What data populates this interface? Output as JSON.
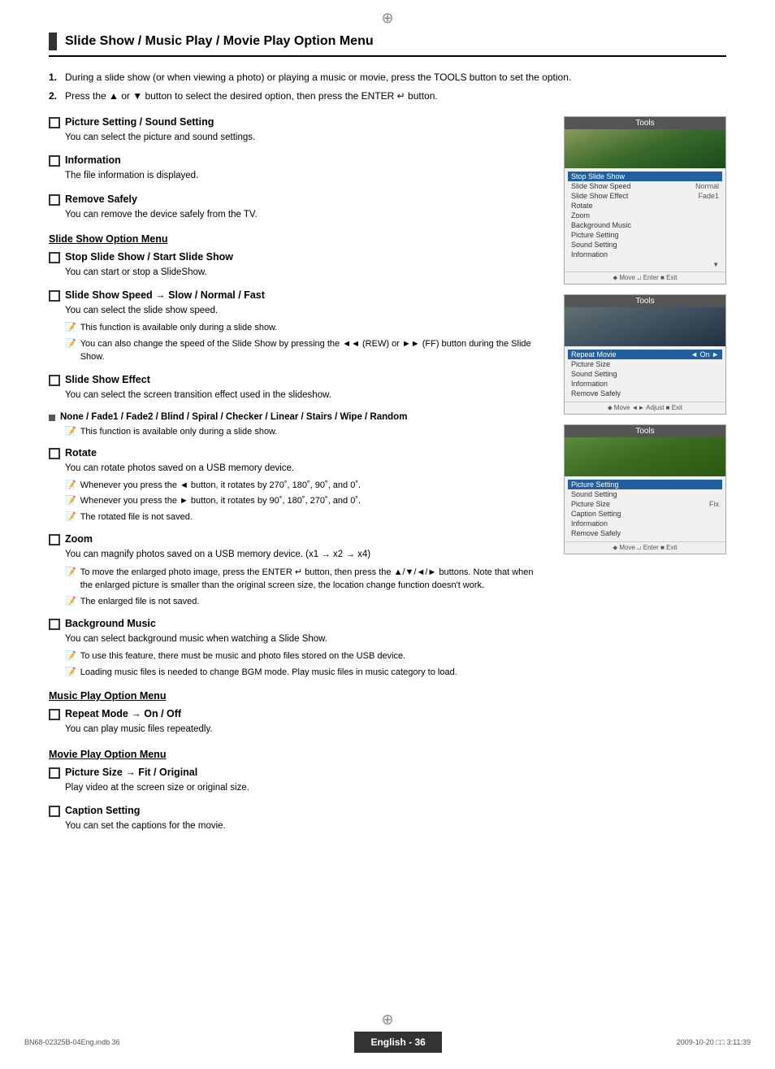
{
  "header": {
    "title": "Slide Show / Music Play / Movie Play Option Menu"
  },
  "intro": {
    "step1": "During a slide show (or when viewing a photo) or playing a music or movie, press the TOOLS button to set the option.",
    "step2": "Press the ▲ or ▼ button to select the desired option, then press the ENTER ↵ button."
  },
  "sections": {
    "pictureSetting": {
      "title": "Picture Setting / Sound Setting",
      "desc": "You can select the picture and sound settings."
    },
    "information": {
      "title": "Information",
      "desc": "The file information is displayed."
    },
    "removeSafely": {
      "title": "Remove Safely",
      "desc": "You can remove the device safely from the TV."
    },
    "slideshowOption": {
      "heading": "Slide Show Option Menu"
    },
    "stopSlideShow": {
      "title": "Stop Slide Show / Start Slide Show",
      "desc": "You can start or stop a SlideShow."
    },
    "slideshowSpeed": {
      "title": "Slide Show Speed → Slow / Normal / Fast",
      "desc": "You can select the slide show speed.",
      "note1": "This function is available only during a slide show.",
      "note2": "You can also change the speed of the Slide Show by pressing the ◄◄ (REW) or ►► (FF) button during the Slide Show."
    },
    "slideshowEffect": {
      "title": "Slide Show Effect",
      "desc": "You can select the screen transition effect used in the slideshow.",
      "options": "None / Fade1 / Fade2 / Blind / Spiral / Checker / Linear / Stairs / Wipe / Random",
      "note": "This function is available only during a slide show."
    },
    "rotate": {
      "title": "Rotate",
      "desc": "You can rotate photos saved on a USB memory device.",
      "note1": "Whenever you press the ◄ button, it rotates by 270˚, 180˚, 90˚, and 0˚.",
      "note2": "Whenever you press the ► button, it rotates by 90˚, 180˚, 270˚, and 0˚.",
      "note3": "The rotated file is not saved."
    },
    "zoom": {
      "title": "Zoom",
      "desc": "You can magnify photos saved on a USB memory device. (x1 → x2 → x4)",
      "note1": "To move the enlarged photo image, press the ENTER ↵ button, then press the ▲/▼/◄/► buttons. Note that when the enlarged picture is smaller than the original screen size, the location change function doesn't work.",
      "note2": "The enlarged file is not saved."
    },
    "backgroundMusic": {
      "title": "Background Music",
      "desc": "You can select background music when watching a Slide Show.",
      "note1": "To use this feature, there must be music and photo files stored on the USB device.",
      "note2": "Loading music files is needed to change BGM mode. Play music files in music category to load."
    },
    "musicOption": {
      "heading": "Music Play Option Menu"
    },
    "repeatMode": {
      "title": "Repeat Mode → On / Off",
      "desc": "You can play music files repeatedly."
    },
    "movieOption": {
      "heading": "Movie Play Option Menu"
    },
    "pictureSize": {
      "title": "Picture Size → Fit / Original",
      "desc": "Play video at the screen size or original size."
    },
    "captionSetting": {
      "title": "Caption Setting",
      "desc": "You can set the captions for the movie."
    }
  },
  "toolsPanels": {
    "panel1": {
      "header": "Tools",
      "menuItems": [
        {
          "label": "Stop Slide Show",
          "value": "",
          "highlighted": true
        },
        {
          "label": "Slide Show Speed",
          "value": "Normal"
        },
        {
          "label": "Slide Show Effect",
          "value": "Fade1"
        },
        {
          "label": "Rotate",
          "value": ""
        },
        {
          "label": "Zoom",
          "value": ""
        },
        {
          "label": "Background Music",
          "value": ""
        },
        {
          "label": "Picture Setting",
          "value": ""
        },
        {
          "label": "Sound Setting",
          "value": ""
        },
        {
          "label": "Information",
          "value": ""
        }
      ],
      "nav": "⬥ Move  ↵ Enter  ■ Exit"
    },
    "panel2": {
      "header": "Tools",
      "menuItems": [
        {
          "label": "Repeat Movie",
          "value": "On",
          "highlighted": true
        },
        {
          "label": "Picture Size",
          "value": ""
        },
        {
          "label": "Sound Setting",
          "value": ""
        },
        {
          "label": "Information",
          "value": ""
        },
        {
          "label": "Remove Safely",
          "value": ""
        }
      ],
      "nav": "⬥ Move  ◄► Adjust  ■ Exit"
    },
    "panel3": {
      "header": "Tools",
      "menuItems": [
        {
          "label": "Picture Setting",
          "value": "",
          "highlighted": true
        },
        {
          "label": "Sound Setting",
          "value": ""
        },
        {
          "label": "Picture Size",
          "value": "Fix"
        },
        {
          "label": "Caption Setting",
          "value": ""
        },
        {
          "label": "Information",
          "value": ""
        },
        {
          "label": "Remove Safely",
          "value": ""
        }
      ],
      "nav": "⬥ Move  ↵ Enter  ■ Exit"
    }
  },
  "footer": {
    "leftText": "BN68-02325B-04Eng.indb   36",
    "centerText": "English - 36",
    "rightText": "2009-10-20   □□ 3:11:39"
  }
}
